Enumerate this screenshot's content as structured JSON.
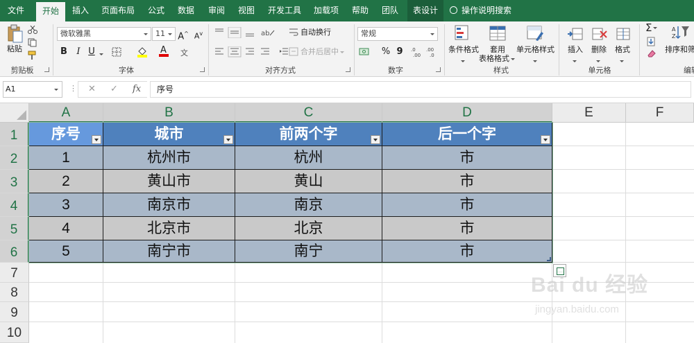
{
  "tabs": [
    {
      "label": "文件",
      "active": false
    },
    {
      "label": "开始",
      "active": true
    },
    {
      "label": "插入",
      "active": false
    },
    {
      "label": "页面布局",
      "active": false
    },
    {
      "label": "公式",
      "active": false
    },
    {
      "label": "数据",
      "active": false
    },
    {
      "label": "审阅",
      "active": false
    },
    {
      "label": "视图",
      "active": false
    },
    {
      "label": "开发工具",
      "active": false
    },
    {
      "label": "加载项",
      "active": false
    },
    {
      "label": "帮助",
      "active": false
    },
    {
      "label": "团队",
      "active": false
    },
    {
      "label": "表设计",
      "active": false,
      "contextual": true
    }
  ],
  "tell_me": "操作说明搜索",
  "ribbon": {
    "clipboard": {
      "group_label": "剪贴板",
      "paste_label": "粘贴"
    },
    "font": {
      "group_label": "字体",
      "font_name": "微软雅黑",
      "font_size": "11",
      "bold": "B",
      "italic": "I",
      "underline": "U",
      "grow": "A",
      "shrink": "A",
      "font_color_glyph": "A"
    },
    "alignment": {
      "group_label": "对齐方式",
      "wrap_text": "自动换行",
      "merge_center": "合并后居中"
    },
    "number": {
      "group_label": "数字",
      "format": "常规",
      "percent": "%",
      "comma": "9",
      "inc_decimal": ".0→.00",
      "dec_decimal": ".00→.0"
    },
    "styles": {
      "group_label": "样式",
      "conditional": "条件格式",
      "table_format_1": "套用",
      "table_format_2": "表格格式",
      "cell_styles": "单元格样式"
    },
    "cells": {
      "group_label": "单元格",
      "insert": "插入",
      "delete": "删除",
      "format": "格式"
    },
    "editing": {
      "group_label": "编辑",
      "sort_filter": "排序和筛",
      "sigma": "Σ"
    }
  },
  "formula_bar": {
    "name_box": "A1",
    "fx": "fx",
    "cancel": "✕",
    "enter": "✓",
    "content": "序号"
  },
  "sheet": {
    "columns": [
      "A",
      "B",
      "C",
      "D",
      "E",
      "F"
    ],
    "rows": [
      "1",
      "2",
      "3",
      "4",
      "5",
      "6",
      "7",
      "8",
      "9",
      "10"
    ],
    "table_headers": [
      "序号",
      "城市",
      "前两个字",
      "后一个字"
    ],
    "table_rows": [
      [
        "1",
        "杭州市",
        "杭州",
        "市"
      ],
      [
        "2",
        "黄山市",
        "黄山",
        "市"
      ],
      [
        "3",
        "南京市",
        "南京",
        "市"
      ],
      [
        "4",
        "北京市",
        "北京",
        "市"
      ],
      [
        "5",
        "南宁市",
        "南宁",
        "市"
      ]
    ],
    "header_color": "#4f81bd",
    "band_colors": [
      "#a9b8c9",
      "#c9c9c9"
    ]
  },
  "watermark": {
    "brand": "Bai du 经验",
    "url": "jingyan.baidu.com"
  }
}
